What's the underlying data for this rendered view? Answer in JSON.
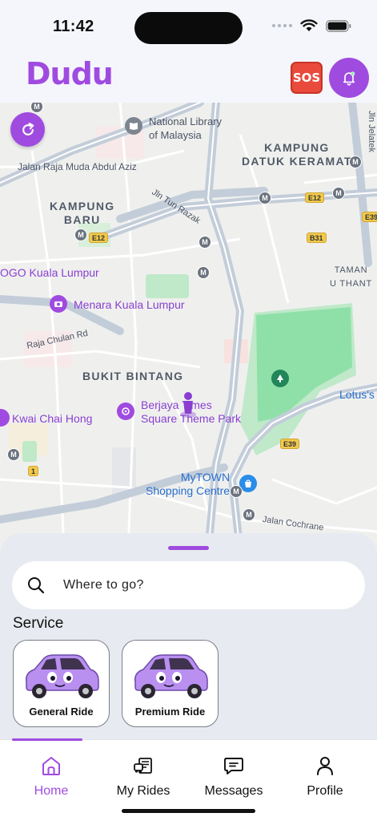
{
  "status_bar": {
    "time": "11:42"
  },
  "header": {
    "app_name": "Dudu",
    "sos_label": "SOS"
  },
  "colors": {
    "brand": "#a04be0",
    "sos": "#e84a3c",
    "park": "#7fd89a",
    "map_bg": "#eff0ee"
  },
  "map": {
    "labels": {
      "national_library": "National Library\nof Malaysia",
      "jalan_raja_muda": "Jalan Raja Muda Abdul Aziz",
      "kampung_datuk_keramat": "KAMPUNG\nDATUK KERAMAT",
      "jln_tun_razak": "Jln Tun Razak",
      "kampung_baru": "KAMPUNG\nBARU",
      "ogo_kuala_lumpur": "OGO Kuala Lumpur",
      "menara_kl": "Menara Kuala Lumpur",
      "taman_u_thant": "TAMAN\nU THANT",
      "raja_chulan": "Raja Chulan Rd",
      "bukit_bintang": "BUKIT BINTANG",
      "berjaya_times": "Berjaya Times\nSquare Theme Park",
      "lotus": "Lotus's",
      "kwai_chai_hong": "Kwai Chai Hong",
      "mytown": "MyTOWN\nShopping Centre",
      "jalan_cochrane": "Jalan Cochrane",
      "jln_jelatek": "Jln Jelatek"
    },
    "shields": {
      "e12_left": "E12",
      "e12_right": "E12",
      "e39_top": "E39",
      "b31": "B31",
      "e39_bottom": "E39",
      "route_1": "1"
    },
    "metro": "M"
  },
  "search": {
    "placeholder": "Where to go?"
  },
  "services": {
    "title": "Service",
    "items": [
      {
        "label": "General Ride"
      },
      {
        "label": "Premium Ride"
      }
    ]
  },
  "tabs": [
    {
      "label": "Home",
      "icon": "home-icon",
      "active": true
    },
    {
      "label": "My Rides",
      "icon": "rides-icon",
      "active": false
    },
    {
      "label": "Messages",
      "icon": "messages-icon",
      "active": false
    },
    {
      "label": "Profile",
      "icon": "profile-icon",
      "active": false
    }
  ]
}
